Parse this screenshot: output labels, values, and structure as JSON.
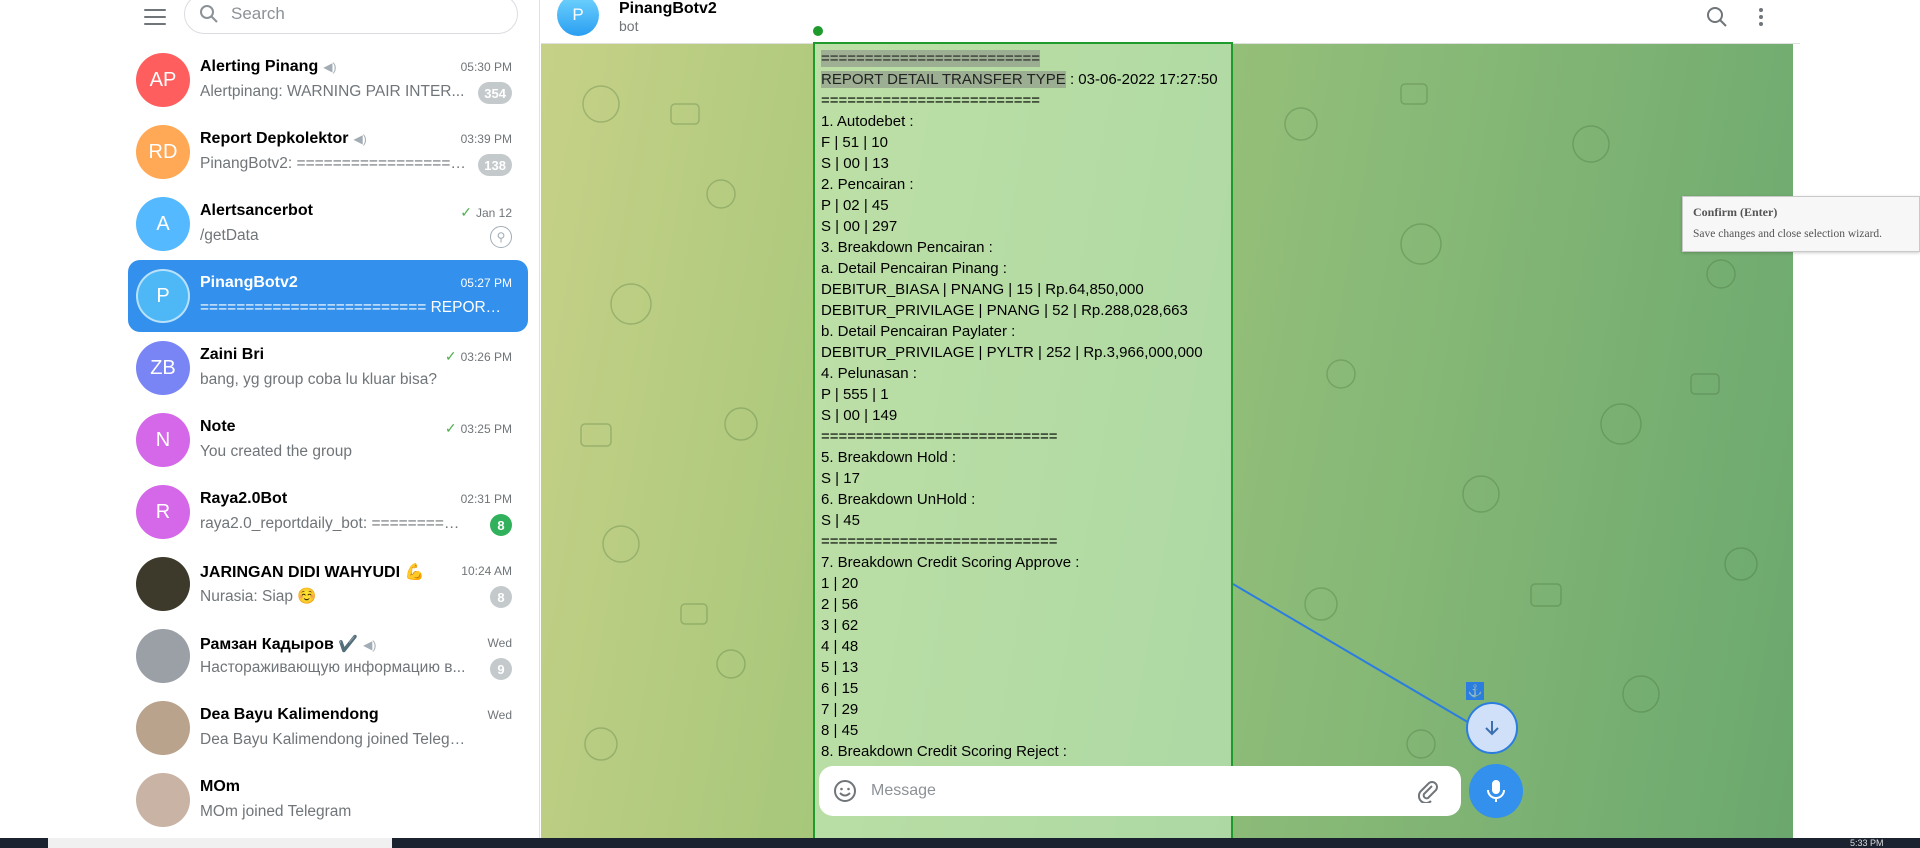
{
  "sidebar": {
    "search_placeholder": "Search",
    "chats": [
      {
        "initials": "AP",
        "title": "Alerting Pinang",
        "time": "05:30 PM",
        "preview": "Alertpinang: WARNING PAIR INTER...",
        "badge": "354",
        "muted": true,
        "color": "#ff5e5e"
      },
      {
        "initials": "RD",
        "title": "Report Depkolektor",
        "time": "03:39 PM",
        "preview": "PinangBotv2: ====================...",
        "badge": "138",
        "muted": true,
        "color": "#ffa855"
      },
      {
        "initials": "A",
        "title": "Alertsancerbot",
        "time": "Jan 12",
        "preview": "/getData",
        "pinned": true,
        "check": true,
        "color": "#55b9ff"
      },
      {
        "initials": "P",
        "title": "PinangBotv2",
        "time": "05:27 PM",
        "preview": "========================= REPORT ...",
        "active": true,
        "color": "#4eb7f5"
      },
      {
        "initials": "ZB",
        "title": "Zaini Bri",
        "time": "03:26 PM",
        "preview": "bang, yg group coba lu kluar bisa?",
        "check": true,
        "color": "#7a85f5"
      },
      {
        "initials": "N",
        "title": "Note",
        "time": "03:25 PM",
        "preview": "You created the group",
        "check": true,
        "color": "#d568e8"
      },
      {
        "initials": "R",
        "title": "Raya2.0Bot",
        "time": "02:31 PM",
        "preview": "raya2.0_reportdaily_bot: ==========...",
        "badge": "8",
        "badge_green": true,
        "color": "#d568e8"
      },
      {
        "initials": "",
        "title": "JARINGAN DIDI WAHYUDI 💪",
        "time": "10:24 AM",
        "preview": "Nurasia: Siap ☺️",
        "badge": "8",
        "muted": true,
        "color": "#3d3a2c"
      },
      {
        "initials": "",
        "title": "Рамзан Кадыров ✔️",
        "time": "Wed",
        "preview": "Настораживающую информацию в...",
        "badge": "9",
        "muted": true,
        "color": "#9aa0a6"
      },
      {
        "initials": "",
        "title": "Dea Bayu Kalimendong",
        "time": "Wed",
        "preview": "Dea Bayu Kalimendong joined Telegram",
        "color": "#b9a38c"
      },
      {
        "initials": "",
        "title": "MOm",
        "time": "",
        "preview": "MOm joined Telegram",
        "color": "#c9b3a4"
      }
    ]
  },
  "header": {
    "avatar": "P",
    "title": "PinangBotv2",
    "subtitle": "bot"
  },
  "message": {
    "lines": [
      {
        "text": "=========================",
        "hl": true
      },
      {
        "hl_text": "REPORT DETAIL TRANSFER TYPE",
        "text": " : 03-06-2022 17:27:50"
      },
      {
        "text": "========================="
      },
      {
        "text": "1. Autodebet :"
      },
      {
        "text": "F | 51 | 10"
      },
      {
        "text": "S | 00 | 13"
      },
      {
        "text": "2. Pencairan :"
      },
      {
        "text": "P | 02 | 45"
      },
      {
        "text": "S | 00 | 297"
      },
      {
        "text": "3. Breakdown Pencairan :"
      },
      {
        "text": "a. Detail Pencairan Pinang  :"
      },
      {
        "text": "DEBITUR_BIASA | PNANG | 15 | Rp.64,850,000"
      },
      {
        "text": "DEBITUR_PRIVILAGE | PNANG | 52 | Rp.288,028,663"
      },
      {
        "text": "b. Detail Pencairan Paylater :"
      },
      {
        "text": "DEBITUR_PRIVILAGE | PYLTR | 252 | Rp.3,966,000,000"
      },
      {
        "text": "4. Pelunasan :"
      },
      {
        "text": "P | 555 | 1"
      },
      {
        "text": "S | 00 | 149"
      },
      {
        "text": "==========================="
      },
      {
        "text": "5. Breakdown Hold   :"
      },
      {
        "text": "S | 17"
      },
      {
        "text": "6. Breakdown UnHold   :"
      },
      {
        "text": "S | 45"
      },
      {
        "text": "==========================="
      },
      {
        "text": "7. Breakdown Credit Scoring Approve   :"
      },
      {
        "text": "1 | 20"
      },
      {
        "text": "2 | 56"
      },
      {
        "text": "3 | 62"
      },
      {
        "text": "4 | 48"
      },
      {
        "text": "5 | 13"
      },
      {
        "text": "6 | 15"
      },
      {
        "text": "7 | 29"
      },
      {
        "text": "8 | 45"
      },
      {
        "text": "8. Breakdown Credit Scoring Reject   :"
      }
    ]
  },
  "composer": {
    "placeholder": "Message"
  },
  "tooltip": {
    "title": "Confirm (Enter)",
    "description": "Save changes and close selection wizard."
  },
  "taskbar": {
    "time": "5:33 PM"
  }
}
